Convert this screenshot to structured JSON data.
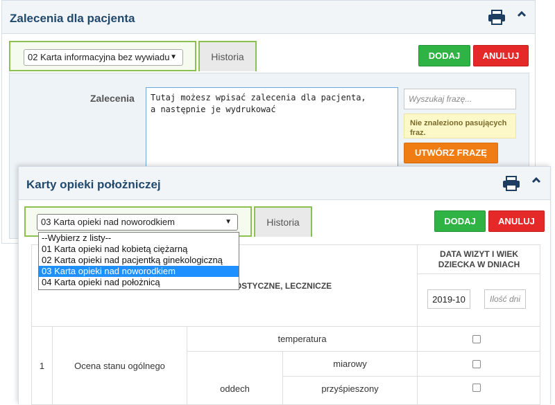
{
  "panel1": {
    "title": "Zalecenia dla pacjenta",
    "select_value": "02 Karta informacyjna bez wywiadu",
    "history_tab": "Historia",
    "add_button": "DODAJ",
    "cancel_button": "ANULUJ",
    "field_label": "Zalecenia",
    "textarea_value": "Tutaj możesz wpisać zalecenia dla pacjenta,\na następnie je wydrukować",
    "search_placeholder": "Wyszukaj frazę...",
    "not_found": "Nie znaleziono pasujących fraz.",
    "create_phrase_button": "UTWÓRZ FRAZĘ"
  },
  "panel2": {
    "title": "Karty opieki położniczej",
    "select_value": "03 Karta opieki nad noworodkiem",
    "history_tab": "Historia",
    "add_button": "DODAJ",
    "cancel_button": "ANULUJ",
    "dropdown_options": [
      "--Wybierz z listy--",
      "01 Karta opieki nad kobietą ciężarną",
      "02 Karta opieki nad pacjentką ginekologiczną",
      "03 Karta opieki nad noworodkiem",
      "04 Karta opieki nad położnicą"
    ],
    "selected_option_index": 3,
    "table": {
      "header_partial": "IAGNOSTYCZNE, LECZNICZE",
      "date_header": "DATA WIZYT I WIEK DZIECKA W DNIACH",
      "date_value": "2019-10",
      "days_placeholder": "Ilość dni",
      "row_number": "1",
      "row_label": "Ocena stanu ogólnego",
      "temperatura": "temperatura",
      "oddech": "oddech",
      "miarowy": "miarowy",
      "przyspieszony": "przyśpieszony"
    }
  },
  "colors": {
    "title": "#21496d",
    "green": "#2fb344",
    "red": "#e52828",
    "orange": "#f07d13",
    "tab_border": "#8cc152"
  }
}
